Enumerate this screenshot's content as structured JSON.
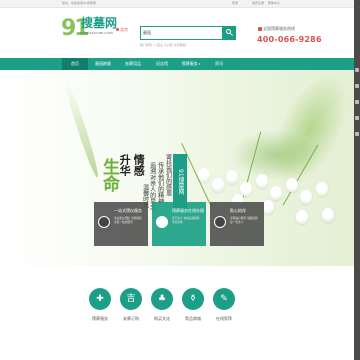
{
  "topbar": {
    "welcome": "您好，欢迎来到91搜墓网",
    "login": "登录",
    "register": "免费注册",
    "help": "帮助中心"
  },
  "logo": {
    "number": "91",
    "name": "搜墓网",
    "domain": "WWW.91SOUMU.COM"
  },
  "city": {
    "name": "北京",
    "icon": "location-pin-icon"
  },
  "search": {
    "type_label": "墓园",
    "placeholder": "",
    "button_icon": "search-icon",
    "hot": "热门搜索: 八宝山   大兴区   北京墓园"
  },
  "hotline": {
    "label": "全国殡葬服务热线",
    "number": "400-066-9286",
    "icon": "phone-icon"
  },
  "nav": {
    "items": [
      {
        "label": "首页",
        "active": true
      },
      {
        "label": "墓园陵墓",
        "active": false
      },
      {
        "label": "丧葬用品",
        "active": false
      },
      {
        "label": "纪念馆",
        "active": false
      },
      {
        "label": "殡葬服务",
        "active": false,
        "caret": "▾"
      },
      {
        "label": "资讯",
        "active": false
      }
    ]
  },
  "banner": {
    "calligraphy_life": "生命",
    "calligraphy_main_1": "升华",
    "calligraphy_main_2": "情感",
    "poem_lines": [
      "追溯对亲人的思念",
      "传承他们的精神",
      "寄托我们的感恩",
      "温馨时光"
    ],
    "seal_text": "91搜墓网"
  },
  "cards": [
    {
      "title": "一站式殡仪服务",
      "desc": "专业殡仪团队 为您提供全程一站式服务",
      "style": "dark",
      "icon": "funeral-service-icon"
    },
    {
      "title": "殡葬服务在线办理",
      "desc": "足不出户 在线完成殡葬手续办理",
      "style": "green",
      "icon": "online-service-icon"
    },
    {
      "title": "贴心陪伴",
      "desc": "全程贴心陪伴 温暖送别每一位亲人",
      "style": "dark",
      "icon": "companion-icon"
    }
  ],
  "carousel": {
    "dots": 5,
    "active_index": 0
  },
  "services": [
    {
      "label": "殡葬服务",
      "icon": "service-icon",
      "glyph": "✚"
    },
    {
      "label": "安葬订购",
      "icon": "order-icon",
      "glyph": "吉"
    },
    {
      "label": "购买文化",
      "icon": "culture-icon",
      "glyph": "♣"
    },
    {
      "label": "祭品商城",
      "icon": "mall-icon",
      "glyph": "⚱"
    },
    {
      "label": "在线祭拜",
      "icon": "worship-icon",
      "glyph": "✎"
    }
  ],
  "colors": {
    "brand": "#1c9f86",
    "brand_dark": "#0f7f69",
    "accent_red": "#d9534f",
    "logo_green": "#86c45b"
  }
}
